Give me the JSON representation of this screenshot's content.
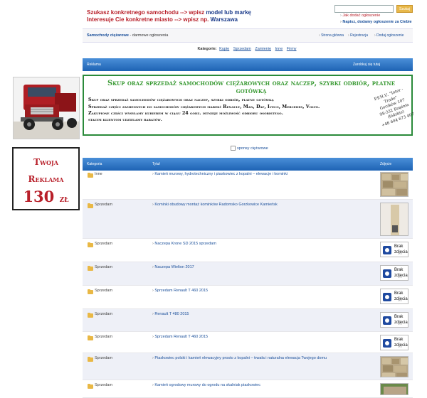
{
  "header": {
    "tagline1_prefix": "Szukasz konkretnego samochodu --> wpisz",
    "tagline1_bold": "model lub markę",
    "tagline2_prefix": "Interesuje Cie konkretne miasto --> wpisz np.",
    "tagline2_bold": "Warszawa",
    "search_button": "Szukaj",
    "link_add": "Jak dodać ogłoszenie",
    "link_write": "Napisz, dodamy ogłoszenie za Ciebie"
  },
  "nav": {
    "breadcrumb_main": "Samochody ciężarowe",
    "breadcrumb_rest": " - darmowe ogłoszenia",
    "links": [
      "Strona główna",
      "Rejestracja",
      "Dodaj ogłoszenie"
    ]
  },
  "categories": {
    "label": "Kategorie:",
    "items": [
      "Kupię",
      "Sprzedam",
      "Zamienię",
      "Inne",
      "Firmy"
    ]
  },
  "reklama_bar": {
    "left": "Reklama",
    "right": "Zarobkuj się tutaj"
  },
  "banner": {
    "title": "Skup oraz sprzedaż samochodów ciężarowych oraz naczep, szybki odbiór, płatne gotówką",
    "lines": [
      "Skup oraz sprzedaż samochodów ciężarowych oraz naczep, szybki odbiór, płatne gotówką",
      "Sprzedaż części zamiennych do samochodów ciężarowych marek: Renault, Man, Daf, Iveco, Mercedes, Volvo.",
      "Zakupione części wysyłamy kurierem w ciągu 24 godz. istnieje możliwość odbioru osobistego.",
      "stałym klientom udzielamy rabatów."
    ],
    "contact": [
      "P.P.H.U. \"Inter - Trade\"",
      "Gorzków 107",
      "98-332 Rząśnia",
      "(łódzkie)",
      "+48 604 673 407"
    ]
  },
  "side_ad": {
    "line1": "Twoja",
    "line2": "Reklama",
    "price": "130",
    "currency": "zł"
  },
  "sponsor_alt": "sponsy ciężarowe",
  "list_header": {
    "col_category": "Kategoria",
    "col_title": "Tytuł",
    "col_photo": "Zdjęcie"
  },
  "brak_label_1": "Brak",
  "brak_label_2": "zdjęcia",
  "listings": [
    {
      "category": "Inne",
      "title": "Kamień murowy, hydrotechniczny i piaskowiec z kopalni – elewacje i kominki",
      "photo": "stone-wall"
    },
    {
      "category": "Sprzedam",
      "title": "Kominki obudowy montaż kominków Radomsko Gorzkowice Kamieńsk",
      "photo": "fireplace"
    },
    {
      "category": "Sprzedam",
      "title": "Naczepa Krone SD 2015 sprzedam",
      "photo": "none"
    },
    {
      "category": "Sprzedam",
      "title": "Naczepa Wielton 2017",
      "photo": "none"
    },
    {
      "category": "Sprzedam",
      "title": "Sprzedam Renault T 460 2015",
      "photo": "none"
    },
    {
      "category": "Sprzedam",
      "title": "Renault T 480 2015",
      "photo": "none"
    },
    {
      "category": "Sprzedam",
      "title": "Sprzedam Renault T 460 2015",
      "photo": "none"
    },
    {
      "category": "Sprzedam",
      "title": "Piaskowiec polski i kamień elewacyjny prosto z kopalni – trwała i naturalna elewacja Twojego domu",
      "photo": "stone-wall"
    },
    {
      "category": "Sprzedam",
      "title": "Kamień ogrodowy murowy do ogrodu na skalniak piaskowiec",
      "photo": "garden"
    }
  ],
  "colors": {
    "accent_red": "#b8202a",
    "link_blue": "#1a4f9a",
    "bar_blue": "#1e63b4",
    "banner_green": "#3a9a34"
  }
}
